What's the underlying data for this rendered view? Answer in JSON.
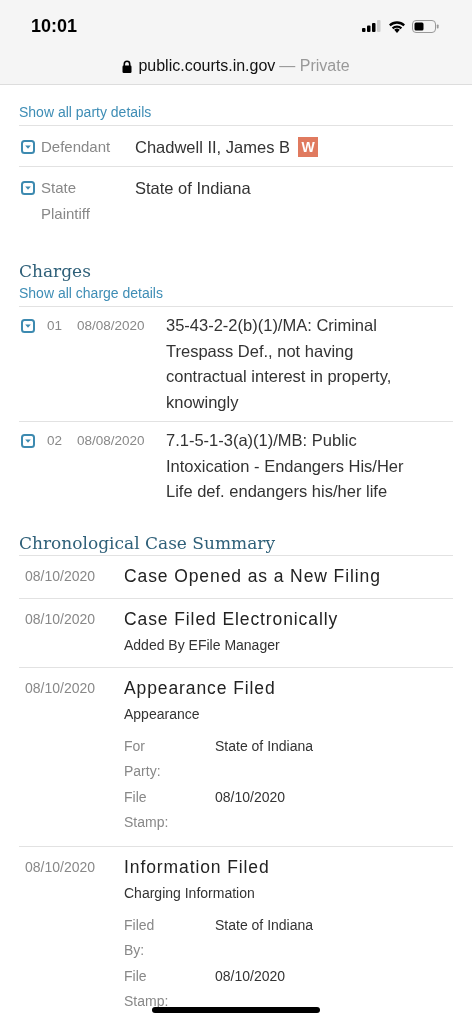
{
  "status_bar": {
    "time": "10:01"
  },
  "address_bar": {
    "url": "public.courts.in.gov",
    "mode": "— Private"
  },
  "parties": {
    "link": "Show all party details",
    "rows": [
      {
        "role": "Defendant",
        "name": "Chadwell II, James B",
        "badge": "W",
        "expanded": false
      },
      {
        "role": "State Plaintiff",
        "name": "State of Indiana",
        "expanded": false
      }
    ]
  },
  "charges": {
    "title": "Charges",
    "link": "Show all charge details",
    "rows": [
      {
        "number": "01",
        "date": "08/08/2020",
        "description": "35-43-2-2(b)(1)/MA: Criminal Trespass Def., not having contractual interest in property, knowingly",
        "expanded": false
      },
      {
        "number": "02",
        "date": "08/08/2020",
        "description": "7.1-5-1-3(a)(1)/MB: Public Intoxication - Endangers His/Her Life def. endangers his/her life",
        "expanded": false
      }
    ]
  },
  "case_summary": {
    "title": "Chronological Case Summary",
    "entries": [
      {
        "date": "08/10/2020",
        "title": "Case Opened as a New Filing"
      },
      {
        "date": "08/10/2020",
        "title": "Case Filed Electronically",
        "subtitle": "Added By EFile Manager"
      },
      {
        "date": "08/10/2020",
        "title": "Appearance Filed",
        "subtitle": "Appearance",
        "fields": [
          {
            "label": "For Party:",
            "value": "State of Indiana"
          },
          {
            "label": "File Stamp:",
            "value": "08/10/2020"
          }
        ]
      },
      {
        "date": "08/10/2020",
        "title": "Information Filed",
        "subtitle": "Charging Information",
        "fields": [
          {
            "label": "Filed By:",
            "value": "State of Indiana"
          },
          {
            "label": "File Stamp:",
            "value": "08/10/2020"
          }
        ]
      }
    ]
  }
}
